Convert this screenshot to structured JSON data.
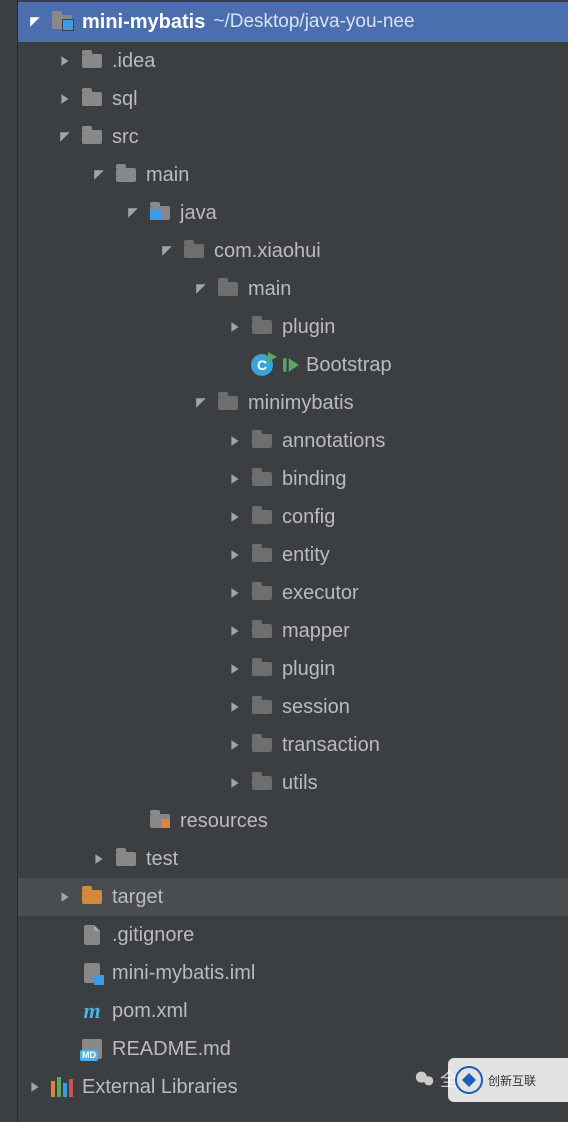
{
  "root": {
    "name": "mini-mybatis",
    "path_suffix": "~/Desktop/java-you-nee"
  },
  "tree": {
    "idea": ".idea",
    "sql": "sql",
    "src": "src",
    "main": "main",
    "java": "java",
    "pkg": "com.xiaohui",
    "pkg_main": "main",
    "plugin": "plugin",
    "bootstrap": "Bootstrap",
    "minimybatis": "minimybatis",
    "annotations": "annotations",
    "binding": "binding",
    "config": "config",
    "entity": "entity",
    "executor": "executor",
    "mapper": "mapper",
    "plugin2": "plugin",
    "session": "session",
    "transaction": "transaction",
    "utils": "utils",
    "resources": "resources",
    "test": "test",
    "target": "target",
    "gitignore": ".gitignore",
    "iml": "mini-mybatis.iml",
    "pom": "pom.xml",
    "readme": "README.md",
    "external": "External Libraries"
  },
  "watermark": {
    "wechat_label": "全",
    "brand": "创新互联"
  }
}
